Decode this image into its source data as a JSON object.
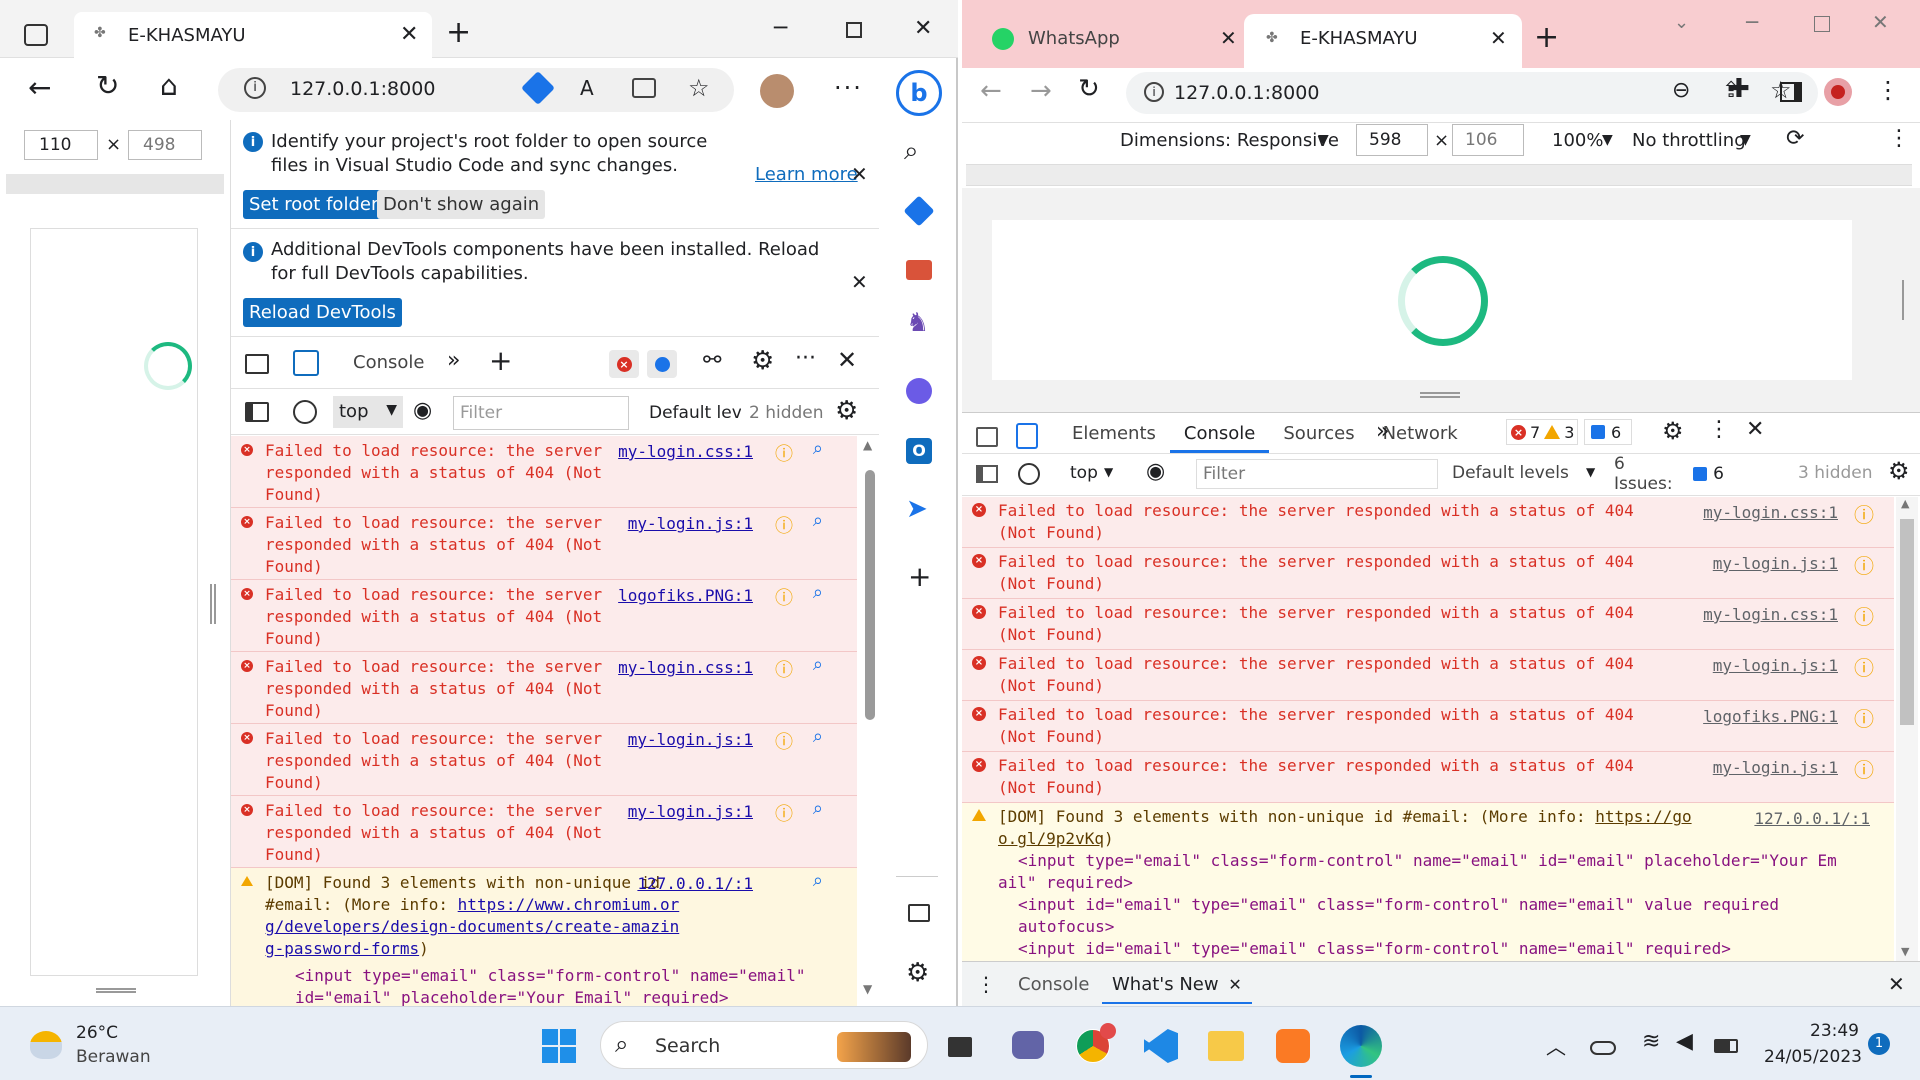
{
  "left": {
    "tab_title": "E-KHASMAYU",
    "url": "127.0.0.1:8000",
    "width_value": "110",
    "height_value": "498",
    "times_sign": "×",
    "notice1_text": "Identify your project's root folder to open source files in Visual Studio Code and sync changes.",
    "notice1_learn": "Learn more",
    "notice1_btn1": "Set root folder",
    "notice1_btn2": "Don't show again",
    "notice2_text": "Additional DevTools components have been installed. Reload for full DevTools capabilities.",
    "notice2_btn": "Reload DevTools",
    "console_tab": "Console",
    "context": "top",
    "filter_placeholder": "Filter",
    "levels": "Default leve",
    "hidden": "2 hidden",
    "messages": [
      {
        "text": "Failed to load resource: the server responded with a status of 404 (Not Found)",
        "source": "my-login.css:1"
      },
      {
        "text": "Failed to load resource: the server responded with a status of 404 (Not Found)",
        "source": "my-login.js:1"
      },
      {
        "text": "Failed to load resource: the server responded with a status of 404 (Not Found)",
        "source": "logofiks.PNG:1"
      },
      {
        "text": "Failed to load resource: the server responded with a status of 404 (Not Found)",
        "source": "my-login.css:1"
      },
      {
        "text": "Failed to load resource: the server responded with a status of 404 (Not Found)",
        "source": "my-login.js:1"
      },
      {
        "text": "Failed to load resource: the server responded with a status of 404 (Not Found)",
        "source": "my-login.js:1"
      }
    ],
    "warn": {
      "text": "[DOM] Found 3 elements with non-unique id #email: (More info:",
      "url": "https://www.chromium.org/developers/design-documents/create-amazing-password-forms",
      "close_paren": ")",
      "source": "127.0.0.1/:1",
      "code1": "<input type=\"email\" class=\"form-control\" name=\"email\"",
      "code2": "id=\"email\" placeholder=\"Your Email\" required>"
    }
  },
  "right": {
    "tab1_title": "WhatsApp",
    "tab2_title": "E-KHASMAYU",
    "url": "127.0.0.1:8000",
    "dimensions": "Dimensions: Responsive",
    "width_value": "598",
    "height_value": "106",
    "times_sign": "×",
    "zoom": "100%",
    "throttle": "No throttling",
    "tabs": [
      "Elements",
      "Console",
      "Sources",
      "Network"
    ],
    "error_count": "7",
    "warn_count": "3",
    "info_count": "6",
    "context": "top",
    "filter_placeholder": "Filter",
    "levels": "Default levels",
    "issues_label": "6 Issues:",
    "issues_count": "6",
    "hidden": "3 hidden",
    "messages": [
      {
        "line1": "Failed to load resource: the server responded with a status of 404",
        "line2": "(Not Found)",
        "source": "my-login.css:1"
      },
      {
        "line1": "Failed to load resource: the server responded with a status of 404",
        "line2": "(Not Found)",
        "source": "my-login.js:1"
      },
      {
        "line1": "Failed to load resource: the server responded with a status of 404",
        "line2": "(Not Found)",
        "source": "my-login.css:1"
      },
      {
        "line1": "Failed to load resource: the server responded with a status of 404",
        "line2": "(Not Found)",
        "source": "my-login.js:1"
      },
      {
        "line1": "Failed to load resource: the server responded with a status of 404",
        "line2": "(Not Found)",
        "source": "logofiks.PNG:1"
      },
      {
        "line1": "Failed to load resource: the server responded with a status of 404",
        "line2": "(Not Found)",
        "source": "my-login.js:1"
      }
    ],
    "warn": {
      "text": "[DOM] Found 3 elements with non-unique id #email: (More info:",
      "url1": "https://go",
      "url2": "o.gl/9p2vKq",
      "close_paren": ")",
      "source": "127.0.0.1/:1",
      "code1": "<input type=\"email\" class=\"form-control\" name=\"email\" id=\"email\" placeholder=\"Your Em",
      "code1b": "ail\" required>",
      "code2": "<input id=\"email\" type=\"email\" class=\"form-control\" name=\"email\" value required",
      "code2b": "autofocus>",
      "code3": "<input id=\"email\" type=\"email\" class=\"form-control\" name=\"email\" required>"
    },
    "drawer_tabs": [
      "Console",
      "What's New"
    ]
  },
  "taskbar": {
    "temp": "26°C",
    "weather": "Berawan",
    "search": "Search",
    "time": "23:49",
    "date": "24/05/2023",
    "notif": "1"
  },
  "colors": {
    "accent": "#0f6cbd",
    "error_bg": "#fcebeb",
    "error_text": "#d93025",
    "warn_bg": "#fef7e0",
    "right_tabbar": "#f8cdd0",
    "spinner": "#1db980"
  }
}
